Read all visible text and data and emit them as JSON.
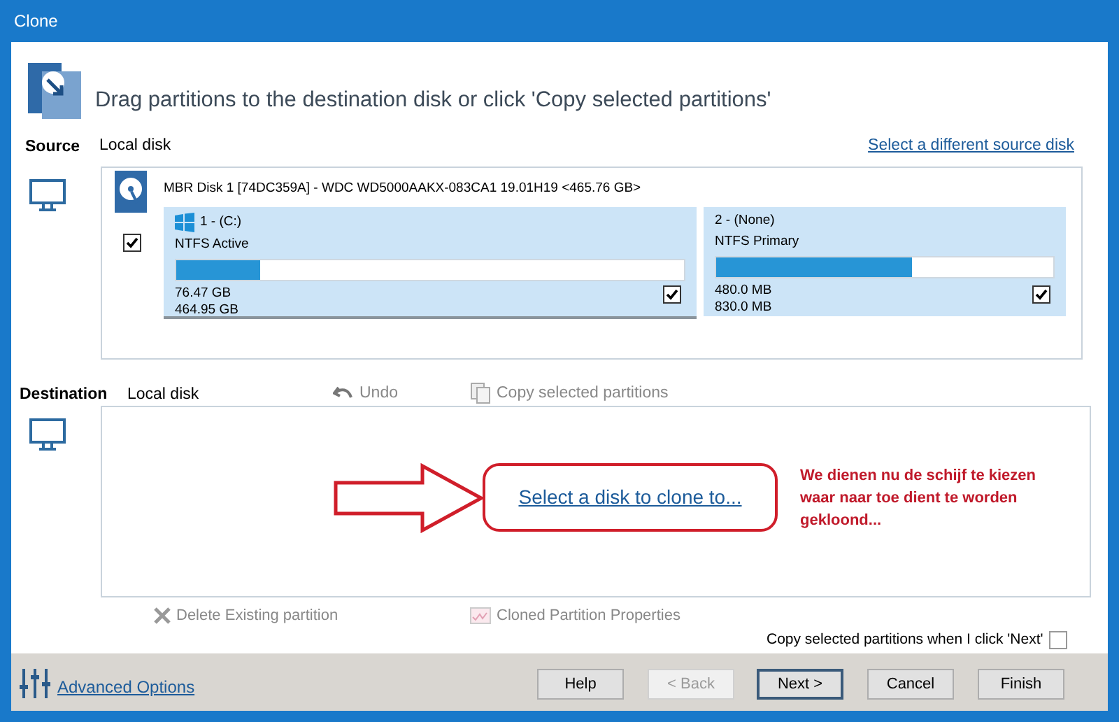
{
  "window": {
    "title": "Clone"
  },
  "header": {
    "text": "Drag partitions to the destination disk or click 'Copy selected partitions'"
  },
  "source": {
    "label": "Source",
    "disk_type": "Local disk",
    "link": "Select a different source disk",
    "disk": {
      "title": "MBR Disk 1 [74DC359A] - WDC WD5000AAKX-083CA1 19.01H19  <465.76 GB>",
      "checked": true,
      "partitions": [
        {
          "kind": "system",
          "name": "1 -  (C:)",
          "fs": "NTFS Active",
          "level": 0.165,
          "used": "76.47 GB",
          "total": "464.95 GB",
          "checked": true,
          "selected": true
        },
        {
          "kind": "data",
          "name": "2 -  (None)",
          "fs": "NTFS Primary",
          "level": 0.58,
          "used": "480.0 MB",
          "total": "830.0 MB",
          "checked": true,
          "selected": false
        }
      ]
    }
  },
  "destination": {
    "label": "Destination",
    "disk_type": "Local disk",
    "tools": [
      {
        "kind": "undo",
        "label": "Undo",
        "disabled": true
      },
      {
        "kind": "copy",
        "label": "Copy selected partitions",
        "disabled": true
      }
    ],
    "select_link": "Select a disk to clone to...",
    "annotation": [
      "We dienen nu de schijf te kiezen",
      "waar naar toe dient te worden",
      "gekloond..."
    ],
    "actions": [
      {
        "kind": "delete",
        "label": "Delete Existing partition",
        "disabled": true
      },
      {
        "kind": "properties",
        "label": "Cloned Partition Properties",
        "disabled": true
      }
    ],
    "copy_on_next": {
      "label": "Copy selected partitions when I click 'Next'",
      "checked": false
    }
  },
  "footer": {
    "advanced": "Advanced Options",
    "buttons": [
      {
        "label": "Help",
        "disabled": false,
        "default": false
      },
      {
        "label": "< Back",
        "disabled": true,
        "default": false
      },
      {
        "label": "Next >",
        "disabled": false,
        "default": true
      },
      {
        "label": "Cancel",
        "disabled": false,
        "default": false
      },
      {
        "label": "Finish",
        "disabled": false,
        "default": false
      }
    ]
  }
}
